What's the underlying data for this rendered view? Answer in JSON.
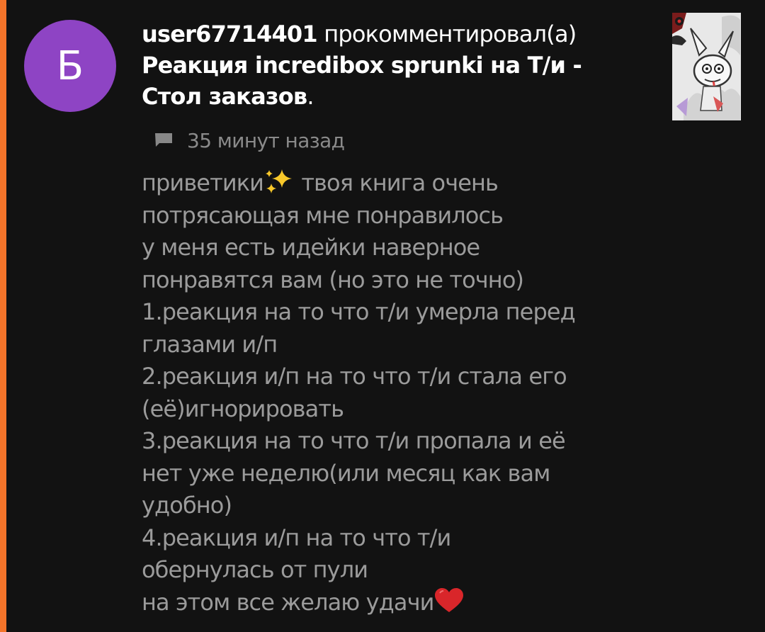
{
  "notification": {
    "avatar": {
      "letter": "Б",
      "color": "#8e44c4"
    },
    "username": "user67714401",
    "action": "прокомментировал(а)",
    "book_title_line1": "Реакция incredibox sprunki на Т/и -",
    "book_title_line2": "Стол заказов",
    "book_title_end": ".",
    "time": "35 минут назад",
    "icon": "comment-icon",
    "accent_color": "#f4742a",
    "comment_lines": [
      "приветики",
      "потрясающая мне понравилось",
      "у меня есть идейки наверное",
      "понравятся вам (но это не точно)",
      "1.реакция на то что т/и умерла перед",
      "глазами и/п",
      "2.реакция и/п на то что т/и стала его",
      "(её)игнорировать",
      "3.реакция на то что т/и пропала и её",
      "нет уже неделю(или месяц как вам",
      "удобно)",
      "4.реакция и/п на то что т/и",
      "обернулась от пули",
      "на этом все желаю удачи"
    ],
    "comment_line1_after_emoji": " твоя книга очень",
    "emojis": [
      "sparkles-icon",
      "red-heart-icon"
    ]
  }
}
